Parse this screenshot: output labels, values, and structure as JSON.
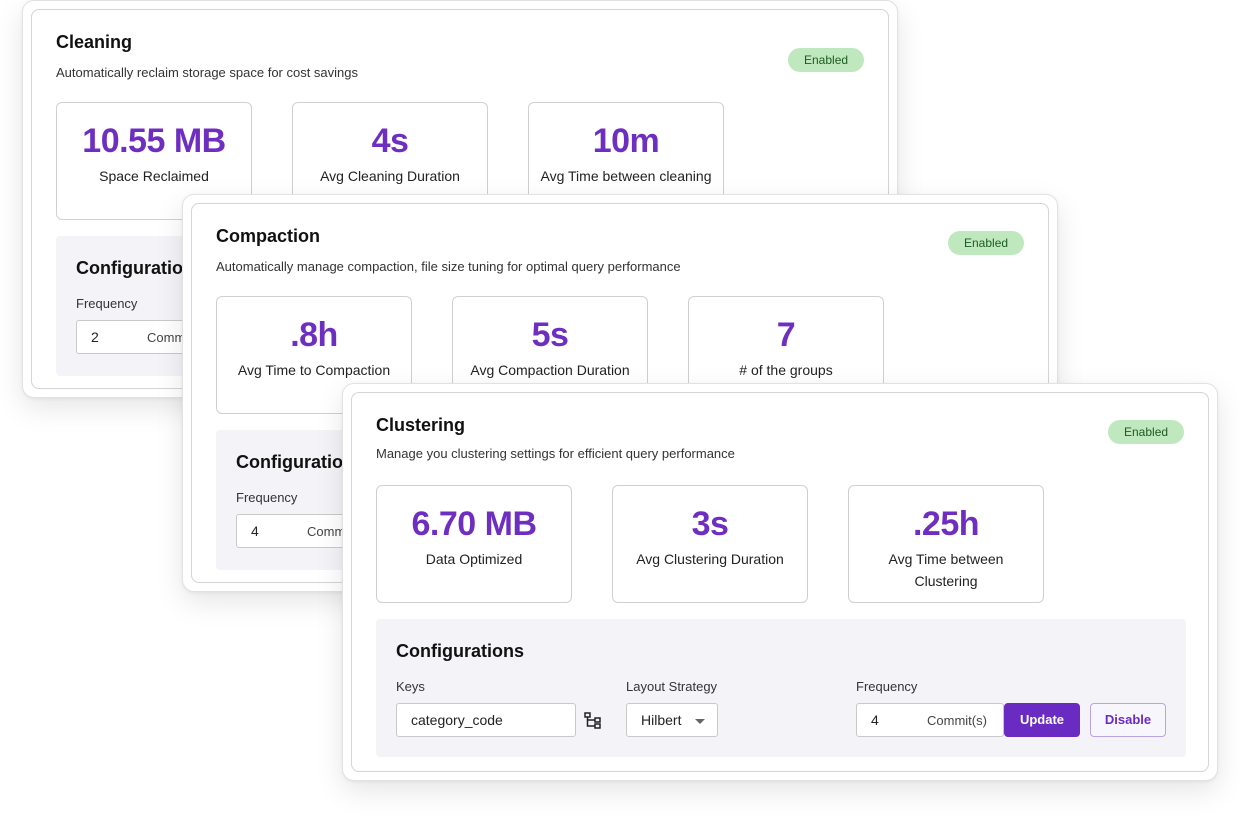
{
  "cleaning": {
    "title": "Cleaning",
    "subtitle": "Automatically reclaim storage space for cost savings",
    "badge": "Enabled",
    "metrics": [
      {
        "value": "10.55 MB",
        "label": "Space Reclaimed"
      },
      {
        "value": "4s",
        "label": "Avg Cleaning Duration"
      },
      {
        "value": "10m",
        "label": "Avg Time between cleaning"
      }
    ],
    "config": {
      "title": "Configuration",
      "frequency_label": "Frequency",
      "frequency_value": "2",
      "frequency_unit": "Comm"
    }
  },
  "compaction": {
    "title": "Compaction",
    "subtitle": "Automatically manage compaction, file size tuning for optimal query performance",
    "badge": "Enabled",
    "metrics": [
      {
        "value": ".8h",
        "label": "Avg Time to Compaction"
      },
      {
        "value": "5s",
        "label": "Avg Compaction Duration"
      },
      {
        "value": "7",
        "label": "# of the groups"
      }
    ],
    "config": {
      "title": "Configuration",
      "frequency_label": "Frequency",
      "frequency_value": "4",
      "frequency_unit": "Comm"
    }
  },
  "clustering": {
    "title": "Clustering",
    "subtitle": "Manage you clustering settings for efficient query performance",
    "badge": "Enabled",
    "metrics": [
      {
        "value": "6.70 MB",
        "label": "Data Optimized"
      },
      {
        "value": "3s",
        "label": "Avg Clustering Duration"
      },
      {
        "value": ".25h",
        "label": "Avg Time between Clustering"
      }
    ],
    "config": {
      "title": "Configurations",
      "keys_label": "Keys",
      "keys_value": "category_code",
      "layout_label": "Layout Strategy",
      "layout_value": "Hilbert",
      "frequency_label": "Frequency",
      "frequency_value": "4",
      "frequency_unit": "Commit(s)",
      "update_label": "Update",
      "disable_label": "Disable"
    }
  },
  "icons": {
    "keys_picker": "hierarchy-icon",
    "layout_dropdown": "chevron-down-icon"
  },
  "colors": {
    "accent": "#6a2bc3",
    "metric_value": "#6e2fc0",
    "badge_bg": "#bfe8be",
    "config_bg": "#f4f3f8"
  }
}
